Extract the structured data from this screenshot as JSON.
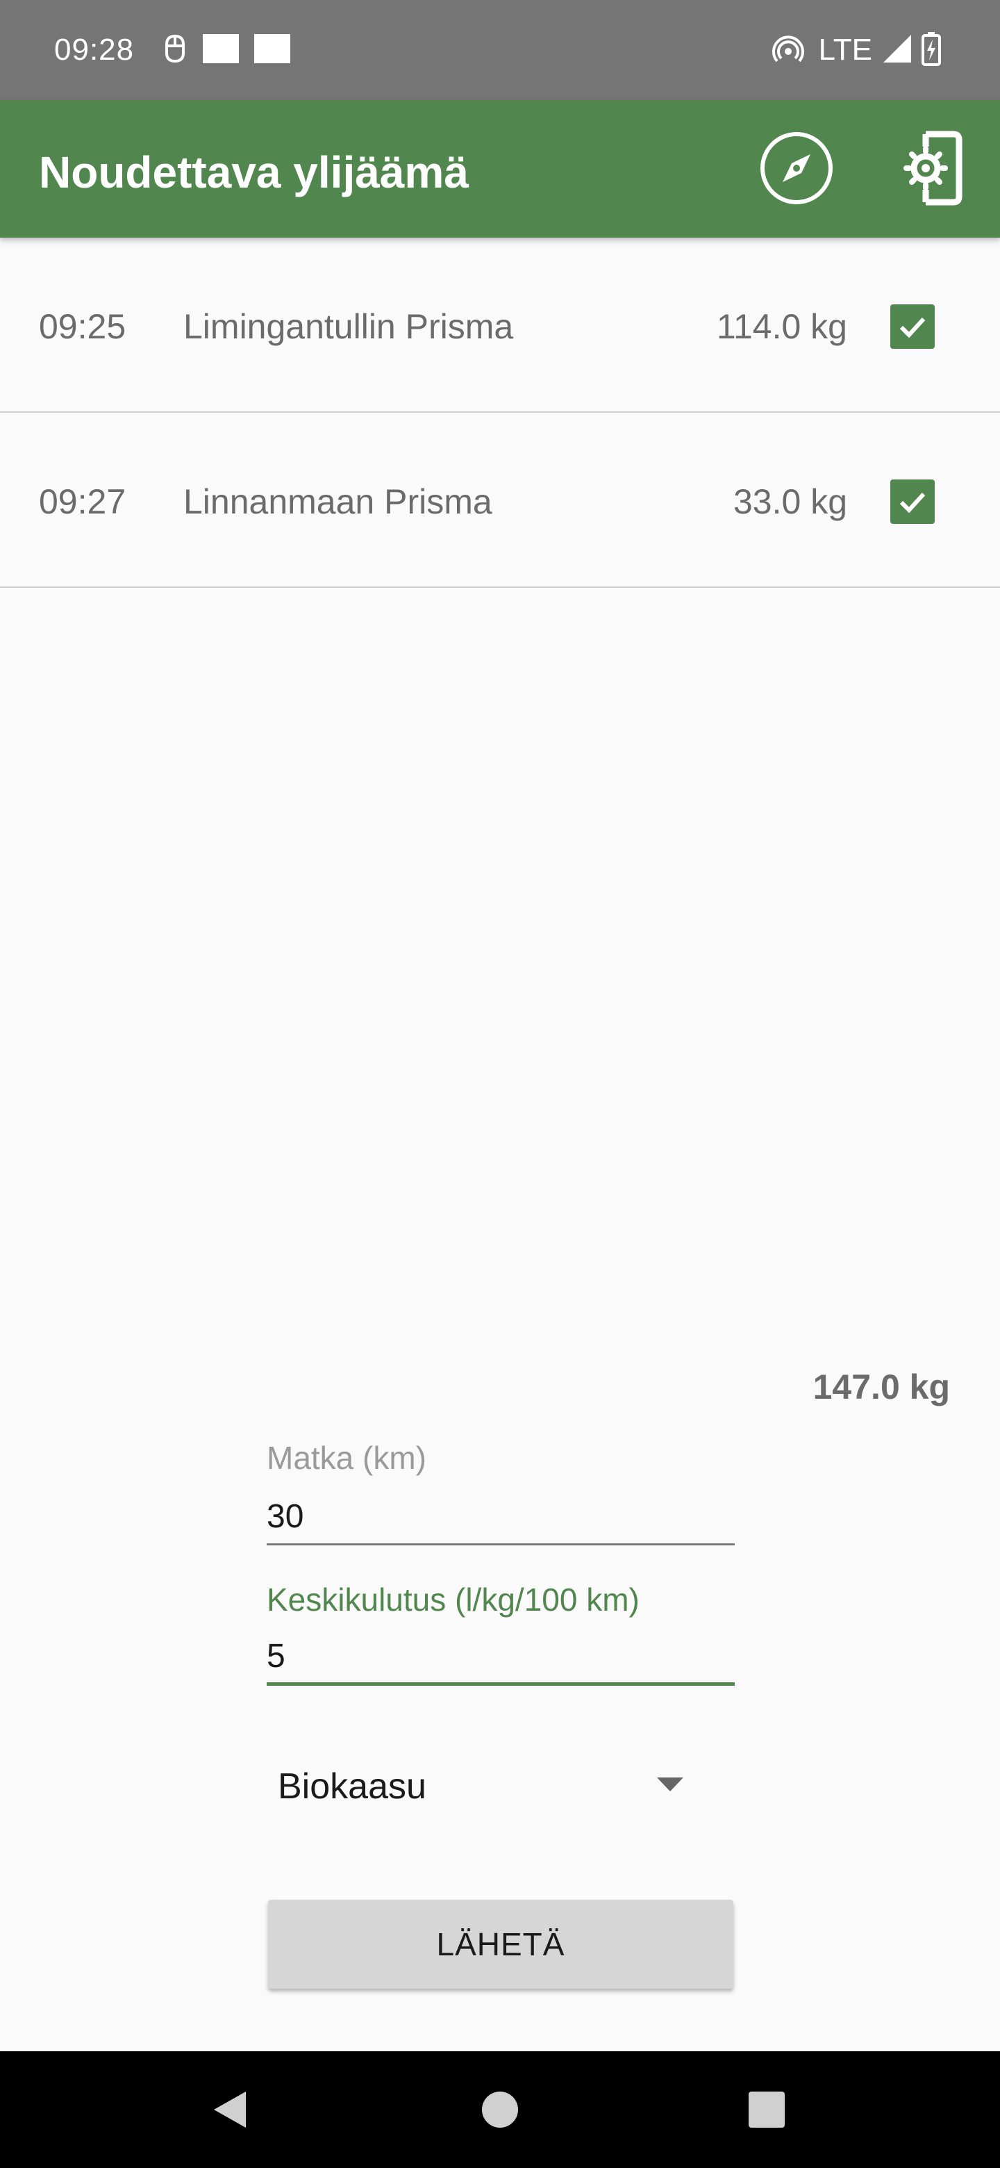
{
  "status_bar": {
    "time": "09:28",
    "network": "LTE",
    "icons": [
      "mouse-icon",
      "notification-square-icon",
      "notification-square-icon",
      "hotspot-icon",
      "signal-icon",
      "battery-charging-icon"
    ]
  },
  "app_bar": {
    "title": "Noudettava ylijäämä",
    "actions": [
      "compass-icon",
      "phone-settings-icon"
    ],
    "color": "#51874f"
  },
  "pickups": [
    {
      "time": "09:25",
      "store": "Limingantullin Prisma",
      "weight": "114.0 kg",
      "checked": true
    },
    {
      "time": "09:27",
      "store": "Linnanmaan Prisma",
      "weight": "33.0 kg",
      "checked": true
    }
  ],
  "total": "147.0 kg",
  "form": {
    "distance_label": "Matka (km)",
    "distance_value": "30",
    "consumption_label": "Keskikulutus (l/kg/100 km)",
    "consumption_value": "5",
    "fuel_selected": "Biokaasu",
    "submit_label": "LÄHETÄ"
  },
  "nav_bar": {
    "buttons": [
      "back-icon",
      "home-icon",
      "recents-icon"
    ]
  }
}
